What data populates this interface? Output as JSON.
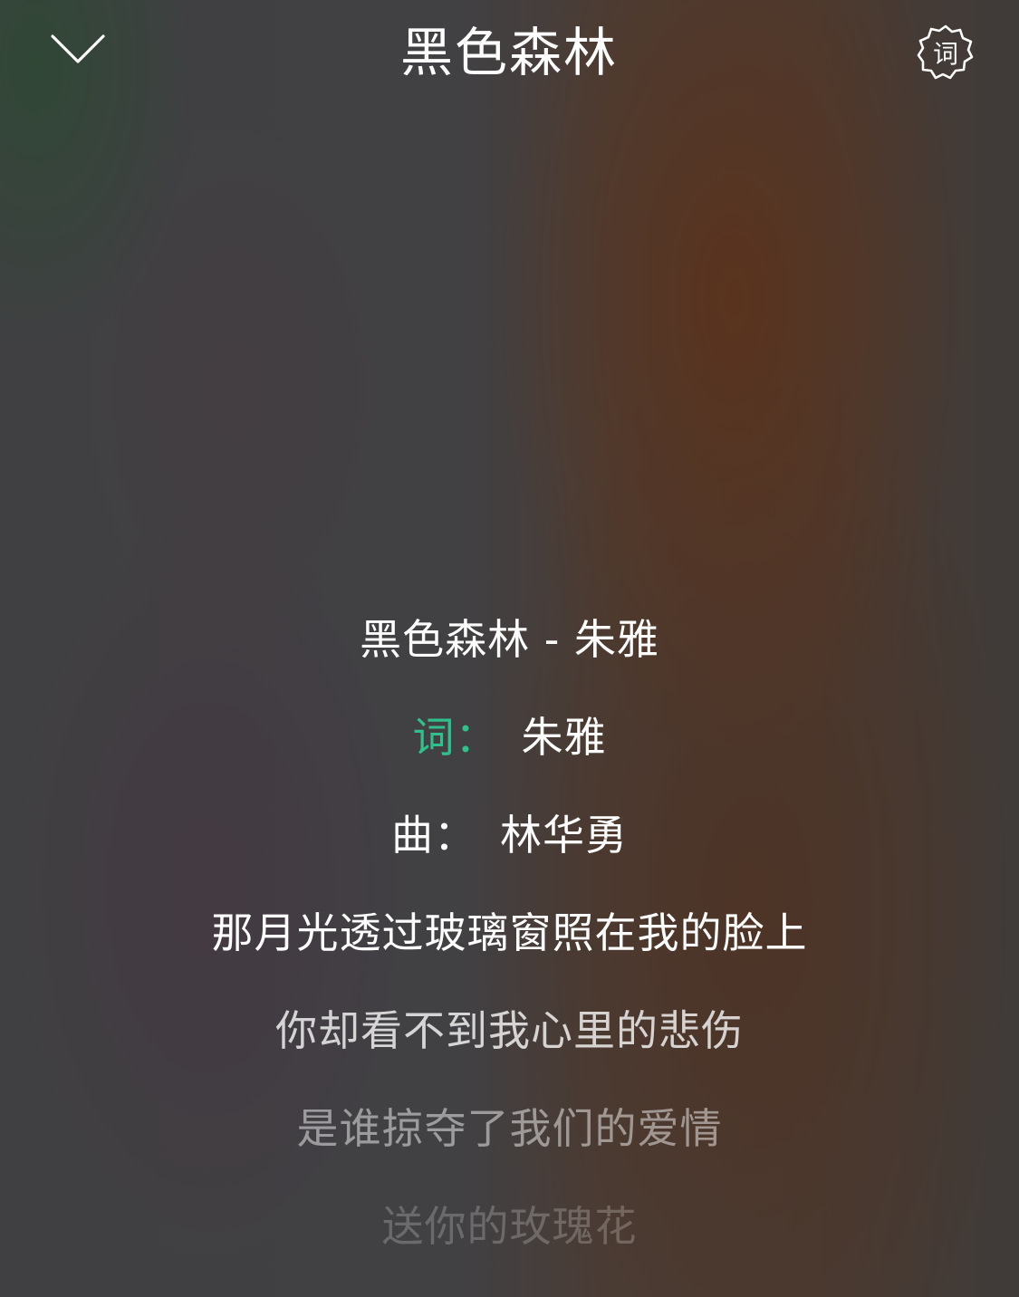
{
  "header": {
    "title": "黑色森林",
    "back_icon": "chevron-down-icon",
    "lyrics_icon": "lyrics-badge-icon",
    "lyrics_icon_label": "词"
  },
  "lyrics": {
    "title_line": "黑色森林 - 朱雅",
    "lyricist_label": "词：",
    "lyricist_name": "朱雅",
    "composer_label": "曲：",
    "composer_name": "林华勇",
    "lines": [
      "那月光透过玻璃窗照在我的脸上",
      "你却看不到我心里的悲伤",
      "是谁掠夺了我们的爱情",
      "送你的玫瑰花"
    ]
  },
  "colors": {
    "accent": "#2fc08b",
    "text": "#ffffff"
  }
}
